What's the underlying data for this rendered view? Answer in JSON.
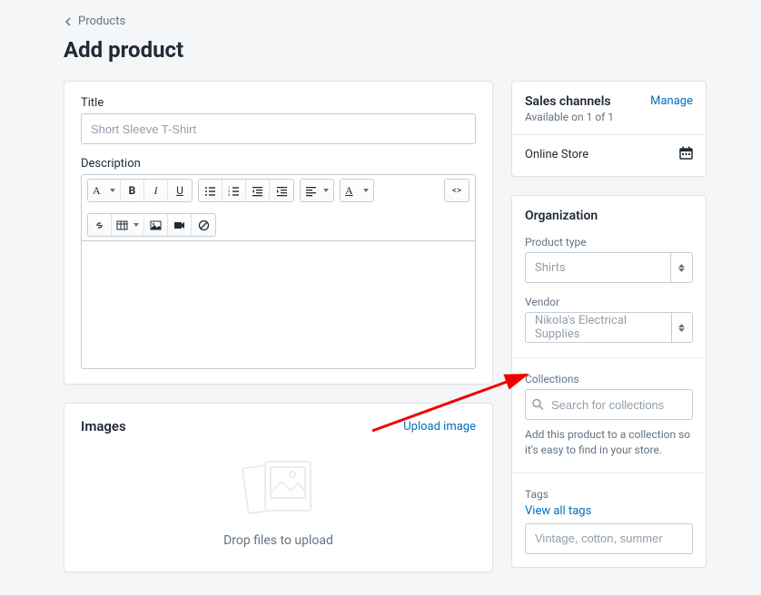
{
  "breadcrumb": {
    "label": "Products"
  },
  "page": {
    "title": "Add product"
  },
  "titleField": {
    "label": "Title",
    "placeholder": "Short Sleeve T-Shirt"
  },
  "description": {
    "label": "Description"
  },
  "images": {
    "heading": "Images",
    "uploadLink": "Upload image",
    "dropText": "Drop files to upload"
  },
  "salesChannels": {
    "heading": "Sales channels",
    "subtext": "Available on 1 of 1",
    "manage": "Manage",
    "channel": "Online Store"
  },
  "organization": {
    "heading": "Organization",
    "productTypeLabel": "Product type",
    "productTypeValue": "Shirts",
    "vendorLabel": "Vendor",
    "vendorValue": "Nikola's Electrical Supplies"
  },
  "collections": {
    "heading": "Collections",
    "placeholder": "Search for collections",
    "helper": "Add this product to a collection so it's easy to find in your store."
  },
  "tags": {
    "heading": "Tags",
    "viewAll": "View all tags",
    "placeholder": "Vintage, cotton, summer"
  }
}
